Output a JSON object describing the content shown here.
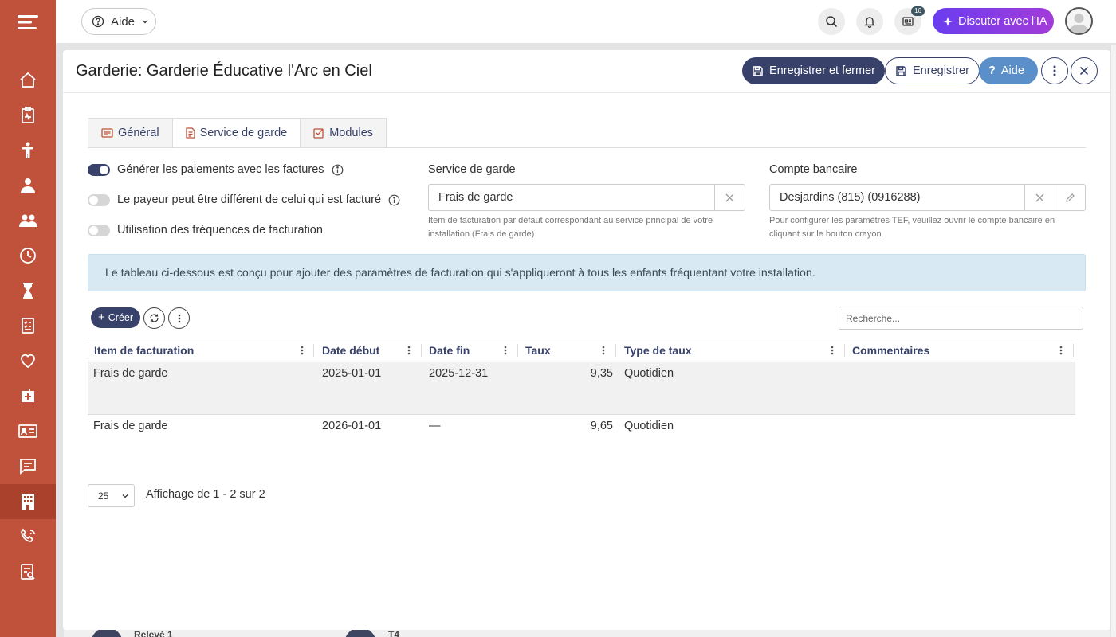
{
  "topbar": {
    "help_label": "Aide",
    "notification_count": "16",
    "ai_label": "Discuter avec l'IA"
  },
  "sidebar": {
    "icons": [
      "menu-icon",
      "home-icon",
      "clipboard-icon",
      "child-icon",
      "person-icon",
      "group-icon",
      "clock-icon",
      "hourglass-icon",
      "checklist-icon",
      "heart-icon",
      "medical-bag-icon",
      "id-card-icon",
      "chat-icon",
      "building-icon",
      "phone-icon",
      "report-icon"
    ],
    "active": "building-icon"
  },
  "panel": {
    "title": "Garderie: Garderie Éducative l'Arc en Ciel",
    "save_close_label": "Enregistrer et fermer",
    "save_label": "Enregistrer",
    "help_label": "Aide"
  },
  "tabs": [
    {
      "label": "Général",
      "active": false
    },
    {
      "label": "Service de garde",
      "active": true
    },
    {
      "label": "Modules",
      "active": false
    }
  ],
  "toggles": [
    {
      "label": "Générer les paiements avec les factures",
      "on": true
    },
    {
      "label": "Le payeur peut être différent de celui qui est facturé",
      "on": false
    },
    {
      "label": "Utilisation des fréquences de facturation",
      "on": false
    }
  ],
  "service_field": {
    "label": "Service de garde",
    "value": "Frais de garde",
    "hint": "Item de facturation par défaut correspondant au service principal de votre installation (Frais de garde)"
  },
  "bank_field": {
    "label": "Compte bancaire",
    "value": "Desjardins (815) (0916288)",
    "hint": "Pour configurer les paramètres TEF, veuillez ouvrir le compte bancaire en cliquant sur le bouton crayon"
  },
  "info_text": "Le tableau ci-dessous est conçu pour ajouter des paramètres de facturation qui s'appliqueront à tous les enfants fréquentant votre installation.",
  "grid": {
    "create_label": "Créer",
    "search_placeholder": "Recherche...",
    "columns": [
      "Item de facturation",
      "Date début",
      "Date fin",
      "Taux",
      "Type de taux",
      "Commentaires"
    ],
    "rows": [
      [
        "Frais de garde",
        "2025-01-01",
        "2025-12-31",
        "9,35",
        "Quotidien",
        ""
      ],
      [
        "Frais de garde",
        "2026-01-01",
        "—",
        "9,65",
        "Quotidien",
        ""
      ]
    ],
    "page_size": "25",
    "pager_info": "Affichage de 1 - 2 sur 2"
  },
  "background": {
    "item1": "Relevé 1",
    "item2": "T4"
  },
  "colors": {
    "sidebar": "#c0513b",
    "primary": "#38416a",
    "info_bg": "#d9e9f3",
    "ai_gradient_start": "#6a3df0",
    "ai_gradient_end": "#a33bd8"
  }
}
